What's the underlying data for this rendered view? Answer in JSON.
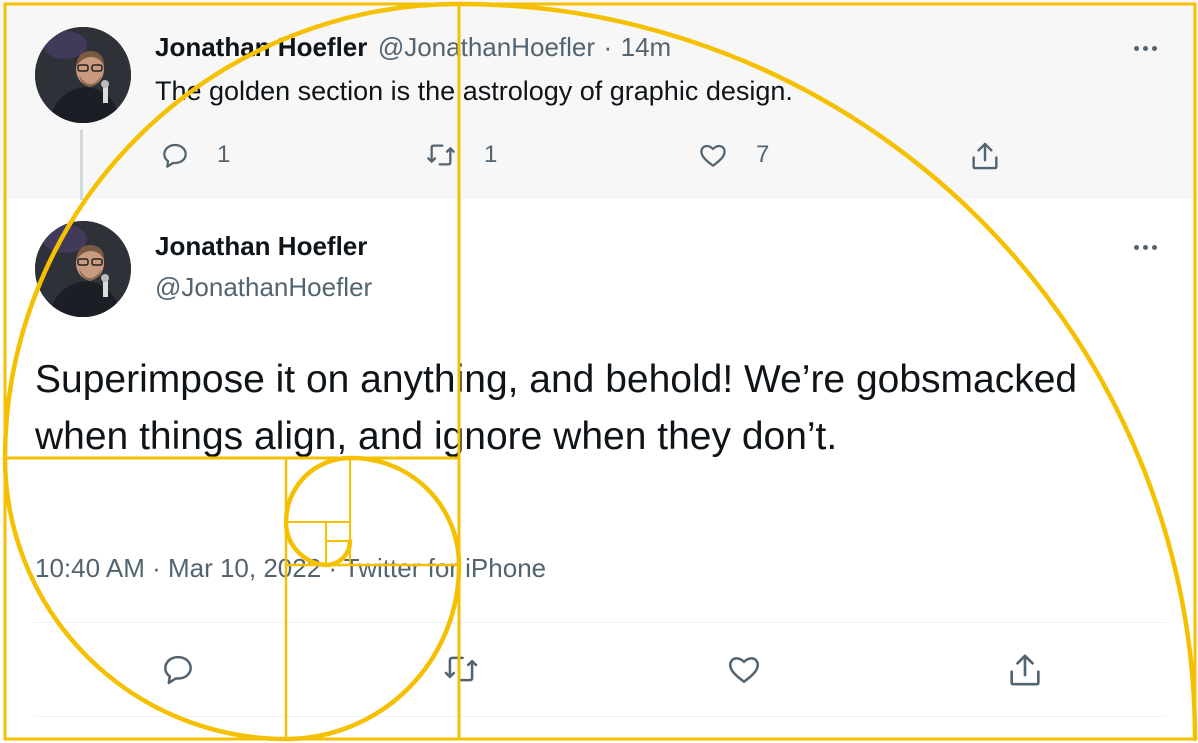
{
  "reply": {
    "author_name": "Jonathan Hoefler",
    "author_handle": "@JonathanHoefler",
    "separator": "·",
    "time": "14m",
    "text": "The golden section is the astrology of graphic design.",
    "counts": {
      "reply": "1",
      "retweet": "1",
      "like": "7"
    }
  },
  "main": {
    "author_name": "Jonathan Hoefler",
    "author_handle": "@JonathanHoefler",
    "text": "Superimpose it on anything, and behold! We’re gobsmacked when things align, and ignore when they don’t.",
    "meta": "10:40 AM · Mar 10, 2022 · Twitter for iPhone"
  },
  "icons": {
    "reply": "speech-bubble-icon",
    "retweet": "retweet-arrows-icon",
    "like": "heart-icon",
    "share": "share-upload-icon",
    "more": "three-dots-icon"
  },
  "colors": {
    "golden_overlay": "#f5c000",
    "secondary_text": "#536471",
    "primary_text": "#0f1419",
    "reply_background": "#f7f7f7"
  }
}
